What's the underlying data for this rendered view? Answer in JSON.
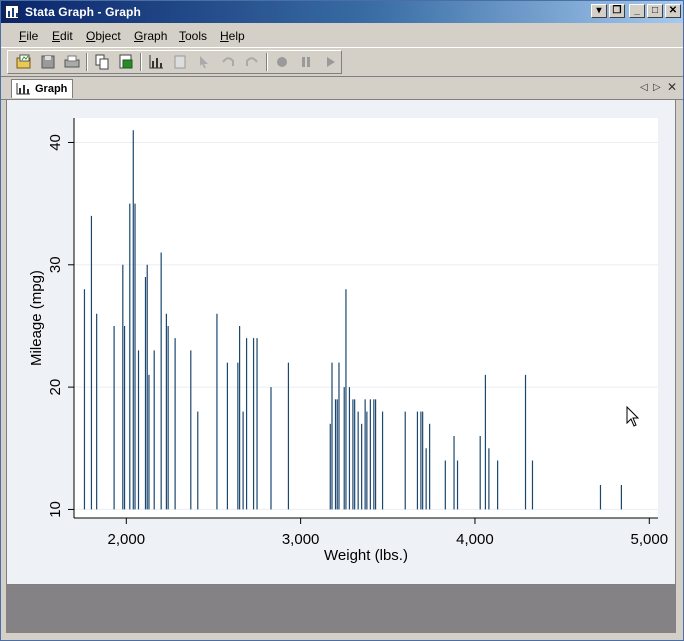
{
  "window": {
    "title": "Stata Graph - Graph"
  },
  "menu": [
    {
      "label": "File",
      "u": "F",
      "rest": "ile"
    },
    {
      "label": "Edit",
      "u": "E",
      "rest": "dit"
    },
    {
      "label": "Object",
      "u": "O",
      "rest": "bject"
    },
    {
      "label": "Graph",
      "u": "G",
      "rest": "raph"
    },
    {
      "label": "Tools",
      "u": "T",
      "rest": "ools"
    },
    {
      "label": "Help",
      "u": "H",
      "rest": "elp"
    }
  ],
  "toolbar": {
    "buttons": [
      "open-graph-icon",
      "save-icon",
      "print-icon",
      "copy-icon",
      "rename-icon",
      "graph-editor-icon",
      "properties-icon",
      "pointer-icon",
      "undo-icon",
      "redo-icon",
      "record-icon",
      "pause-icon",
      "play-icon"
    ]
  },
  "tab": {
    "label": "Graph"
  },
  "colors": {
    "spike": "#1a476f",
    "plotbg": "#ffffff",
    "outerbg": "#eef2f7"
  },
  "chart_data": {
    "type": "spike",
    "xlabel": "Weight (lbs.)",
    "ylabel": "Mileage (mpg)",
    "xlim": [
      1700,
      5050
    ],
    "ylim": [
      9.3,
      42
    ],
    "xticks": [
      2000,
      3000,
      4000,
      5000
    ],
    "xtick_labels": [
      "2,000",
      "3,000",
      "4,000",
      "5,000"
    ],
    "yticks": [
      10,
      20,
      30,
      40
    ],
    "ytick_labels": [
      "10",
      "20",
      "30",
      "40"
    ],
    "grid": true,
    "base": 10,
    "points": [
      [
        1760,
        28
      ],
      [
        1800,
        34
      ],
      [
        1830,
        26
      ],
      [
        1930,
        25
      ],
      [
        1980,
        30
      ],
      [
        1990,
        25
      ],
      [
        2020,
        35
      ],
      [
        2040,
        41
      ],
      [
        2050,
        35
      ],
      [
        2070,
        23
      ],
      [
        2110,
        29
      ],
      [
        2120,
        30
      ],
      [
        2130,
        21
      ],
      [
        2160,
        23
      ],
      [
        2200,
        31
      ],
      [
        2230,
        26
      ],
      [
        2240,
        25
      ],
      [
        2280,
        24
      ],
      [
        2370,
        23
      ],
      [
        2410,
        18
      ],
      [
        2520,
        26
      ],
      [
        2580,
        22
      ],
      [
        2640,
        22
      ],
      [
        2650,
        25
      ],
      [
        2670,
        18
      ],
      [
        2690,
        24
      ],
      [
        2730,
        24
      ],
      [
        2750,
        24
      ],
      [
        2830,
        20
      ],
      [
        2930,
        22
      ],
      [
        3170,
        17
      ],
      [
        3180,
        22
      ],
      [
        3200,
        19
      ],
      [
        3210,
        19
      ],
      [
        3220,
        22
      ],
      [
        3250,
        20
      ],
      [
        3260,
        28
      ],
      [
        3280,
        20
      ],
      [
        3300,
        19
      ],
      [
        3310,
        19
      ],
      [
        3330,
        18
      ],
      [
        3350,
        17
      ],
      [
        3370,
        19
      ],
      [
        3380,
        18
      ],
      [
        3400,
        19
      ],
      [
        3420,
        19
      ],
      [
        3430,
        19
      ],
      [
        3470,
        18
      ],
      [
        3600,
        18
      ],
      [
        3670,
        18
      ],
      [
        3690,
        18
      ],
      [
        3700,
        18
      ],
      [
        3720,
        15
      ],
      [
        3740,
        17
      ],
      [
        3830,
        14
      ],
      [
        3880,
        16
      ],
      [
        3900,
        14
      ],
      [
        4030,
        16
      ],
      [
        4060,
        21
      ],
      [
        4080,
        15
      ],
      [
        4130,
        14
      ],
      [
        4290,
        21
      ],
      [
        4330,
        14
      ],
      [
        4720,
        12
      ],
      [
        4840,
        12
      ]
    ]
  }
}
